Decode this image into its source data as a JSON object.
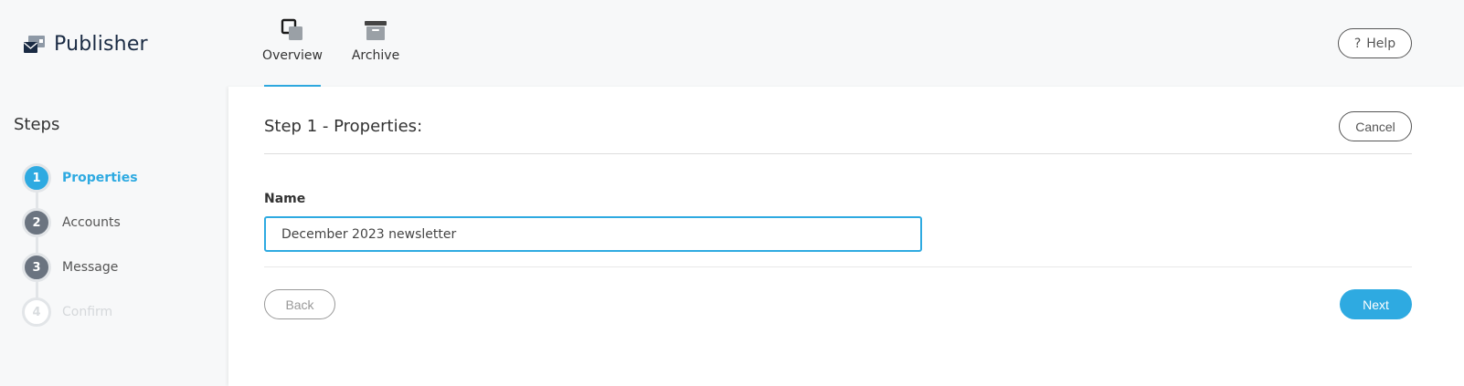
{
  "app": {
    "title": "Publisher",
    "logo_icon": "publisher-logo-icon"
  },
  "nav": {
    "tabs": [
      {
        "label": "Overview",
        "icon": "overview-icon",
        "active": true
      },
      {
        "label": "Archive",
        "icon": "archive-icon",
        "active": false
      }
    ],
    "help_label": "Help",
    "help_icon": "?"
  },
  "sidebar": {
    "title": "Steps",
    "steps": [
      {
        "number": "1",
        "label": "Properties",
        "state": "active"
      },
      {
        "number": "2",
        "label": "Accounts",
        "state": "done"
      },
      {
        "number": "3",
        "label": "Message",
        "state": "done"
      },
      {
        "number": "4",
        "label": "Confirm",
        "state": "pending"
      }
    ]
  },
  "main": {
    "title": "Step 1 - Properties:",
    "cancel_label": "Cancel",
    "name_label": "Name",
    "name_value": "December 2023 newsletter",
    "back_label": "Back",
    "next_label": "Next"
  },
  "colors": {
    "accent": "#2eaae1",
    "step_done": "#6b7480",
    "brand_text": "#1a2b44"
  }
}
